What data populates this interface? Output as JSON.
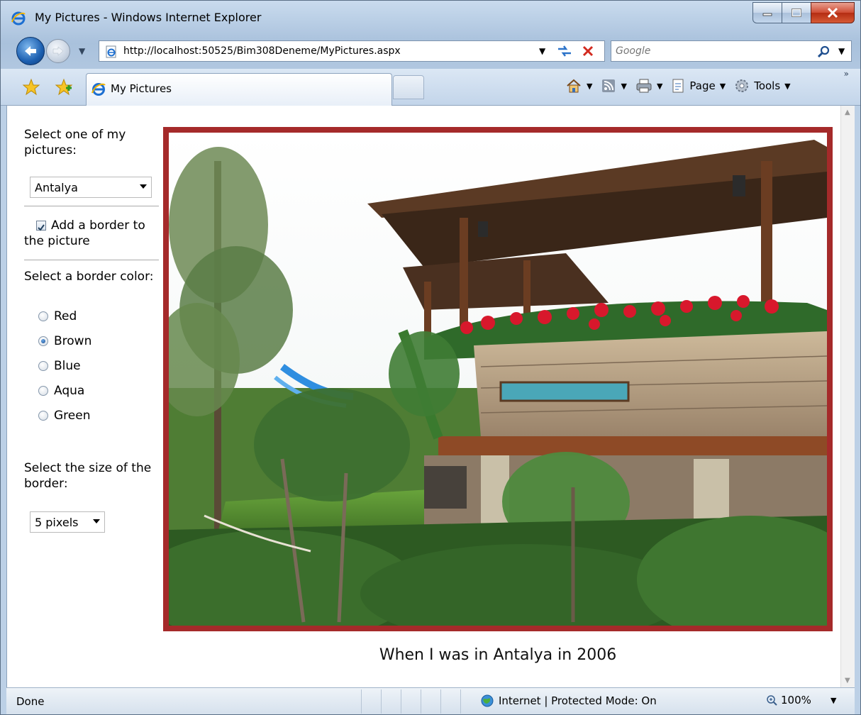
{
  "window": {
    "title": "My Pictures - Windows Internet Explorer"
  },
  "address_bar": {
    "url": "http://localhost:50525/Bim308Deneme/MyPictures.aspx"
  },
  "search": {
    "placeholder": "Google"
  },
  "tab": {
    "label": "My Pictures"
  },
  "commands": {
    "page": "Page",
    "tools": "Tools"
  },
  "form": {
    "picture_label": "Select one of my pictures:",
    "picture_selected": "Antalya",
    "border_checkbox_label": "Add a border to the picture",
    "border_checked": true,
    "color_label": "Select a border color:",
    "colors": [
      "Red",
      "Brown",
      "Blue",
      "Aqua",
      "Green"
    ],
    "selected_color": "Brown",
    "size_label": "Select the size of the border:",
    "size_selected": "5 pixels"
  },
  "picture": {
    "caption": "When I was in Antalya in 2006",
    "border_color": "#a52a2a"
  },
  "status": {
    "text": "Done",
    "zone": "Internet | Protected Mode: On",
    "zoom": "100%"
  }
}
